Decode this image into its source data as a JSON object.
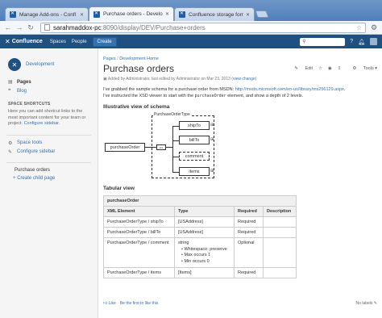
{
  "browser": {
    "tabs": [
      {
        "label": "Manage Add-ons - Confl"
      },
      {
        "label": "Purchase orders - Develop"
      },
      {
        "label": "Confluence storage format"
      }
    ],
    "address_host": "sarahmaddox-pc",
    "address_path": ":8090/display/DEV/Purchase+orders"
  },
  "header": {
    "product": "Confluence",
    "nav": [
      "Spaces",
      "People"
    ],
    "create_label": "Create"
  },
  "sidebar": {
    "space_name": "Development",
    "items": [
      {
        "label": "Pages"
      },
      {
        "label": "Blog"
      }
    ],
    "shortcuts_heading": "SPACE SHORTCUTS",
    "shortcuts_text": "Here you can add shortcut links to the most important content for your team or project.",
    "shortcuts_link": "Configure sidebar.",
    "tools": [
      {
        "label": "Space tools"
      },
      {
        "label": "Configure sidebar"
      }
    ],
    "current_page": "Purchase orders",
    "child_page": "Create child page"
  },
  "page": {
    "breadcrumb": [
      "Pages",
      "Development Home"
    ],
    "title": "Purchase orders",
    "actions": {
      "edit": "Edit",
      "tools": "Tools"
    },
    "byline_prefix": "Added by Administrator, last edited by Administrator on Mar 23, 2013  (",
    "byline_link": "view change",
    "byline_suffix": ")",
    "intro_1_text": "I've grabbed the sample schema for a purchase order from MSDN: ",
    "intro_1_url": "http://msdn.microsoft.com/en-us/library/ms256129.aspx",
    "intro_1_end": ".",
    "intro_2_text": "I've instructed the XSD viewer to start with the ",
    "intro_2_code": "purchaseOrder",
    "intro_2_end": " element, and show a depth of 2 levels.",
    "illustrative_heading": "Illustrative view of schema",
    "diagram": {
      "root": "purchaseOrder",
      "type": "PurchaseOrderType",
      "children": [
        "shipTo",
        "billTo",
        "comment",
        "items"
      ]
    },
    "tabular_heading": "Tabular view",
    "table": {
      "caption": "purchaseOrder",
      "headers": [
        "XML Element",
        "Type",
        "Required",
        "Description"
      ],
      "rows": [
        {
          "element": "PurchaseOrderType / shipTo",
          "type": "[USAddress]",
          "required": "Required",
          "description": ""
        },
        {
          "element": "PurchaseOrderType / billTo",
          "type": "[USAddress]",
          "required": "Required",
          "description": ""
        },
        {
          "element": "PurchaseOrderType / comment",
          "type": "string",
          "type_details": [
            "Whitespace: preserve",
            "Max occurs 1",
            "Min occurs 0"
          ],
          "required": "Optional",
          "description": ""
        },
        {
          "element": "PurchaseOrderType / items",
          "type": "[Items]",
          "required": "Required",
          "description": ""
        }
      ]
    },
    "footer": {
      "like": "Like",
      "be_first": "Be the first to like this",
      "labels": "No labels"
    }
  },
  "colors": {
    "header_bg": "#205081",
    "link": "#3572b0",
    "sidebar_bg": "#f5f5f5"
  },
  "icons": [
    "confluence-x-icon",
    "close-icon",
    "page-icon",
    "star-icon",
    "wrench-icon",
    "search-icon",
    "help-icon",
    "bell-icon",
    "edit-icon",
    "gear-icon",
    "pages-icon",
    "blog-icon",
    "like-icon",
    "label-icon"
  ]
}
